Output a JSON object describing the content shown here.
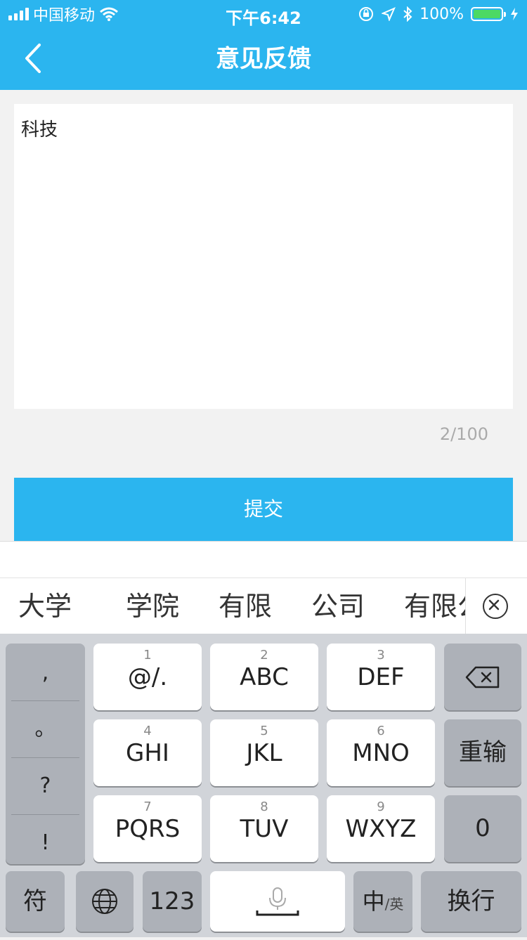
{
  "status_bar": {
    "carrier": "中国移动",
    "time": "下午6:42",
    "battery": "100%"
  },
  "nav": {
    "title": "意见反馈"
  },
  "feedback": {
    "text": "科技",
    "counter": "2/100"
  },
  "submit_label": "提交",
  "keyboard": {
    "candidates": [
      "大学",
      "学院",
      "有限",
      "公司",
      "有限公"
    ],
    "punctuation": [
      ",",
      "。",
      "?",
      "!"
    ],
    "keys": [
      {
        "num": "1",
        "label": "@/."
      },
      {
        "num": "2",
        "label": "ABC"
      },
      {
        "num": "3",
        "label": "DEF"
      },
      {
        "num": "4",
        "label": "GHI"
      },
      {
        "num": "5",
        "label": "JKL"
      },
      {
        "num": "6",
        "label": "MNO"
      },
      {
        "num": "7",
        "label": "PQRS"
      },
      {
        "num": "8",
        "label": "TUV"
      },
      {
        "num": "9",
        "label": "WXYZ"
      }
    ],
    "reinput_label": "重输",
    "zero_label": "0",
    "symbols_label": "符",
    "numbers_label": "123",
    "lang_main": "中",
    "lang_sub": "/英",
    "return_label": "换行"
  },
  "colors": {
    "accent": "#2bb5ef",
    "battery_fill": "#4cd964"
  }
}
